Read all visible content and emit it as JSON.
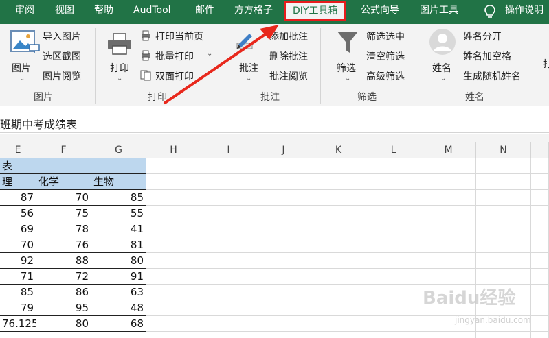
{
  "tabs": [
    "审阅",
    "视图",
    "帮助",
    "AudTool",
    "邮件",
    "方方格子",
    "DIY工具箱",
    "公式向导",
    "图片工具"
  ],
  "help_label": "操作说明",
  "ribbon": {
    "picture": {
      "big_label": "图片",
      "items": [
        "导入图片",
        "选区截图",
        "图片阅览"
      ],
      "group_label": "图片"
    },
    "print": {
      "big_label": "打印",
      "items": [
        "打印当前页",
        "批量打印",
        "双面打印"
      ],
      "group_label": "打印"
    },
    "comment": {
      "big_label": "批注",
      "items": [
        "添加批注",
        "删除批注",
        "批注阅览"
      ],
      "group_label": "批注"
    },
    "filter": {
      "big_label": "筛选",
      "items": [
        "筛选选中",
        "清空筛选",
        "高级筛选"
      ],
      "group_label": "筛选"
    },
    "name": {
      "big_label": "姓名",
      "items": [
        "姓名分开",
        "姓名加空格",
        "生成随机姓名"
      ],
      "group_label": "姓名"
    },
    "extra_label": "打"
  },
  "formula_bar": {
    "text": "班期中考成绩表"
  },
  "columns": [
    "E",
    "F",
    "G",
    "H",
    "I",
    "J",
    "K",
    "L",
    "M",
    "N"
  ],
  "sheet": {
    "title_fragment": "表",
    "headers": [
      "理",
      "化学",
      "生物"
    ],
    "rows": [
      [
        "87",
        "70",
        "85"
      ],
      [
        "56",
        "75",
        "55"
      ],
      [
        "69",
        "78",
        "41"
      ],
      [
        "70",
        "76",
        "81"
      ],
      [
        "92",
        "88",
        "80"
      ],
      [
        "71",
        "72",
        "91"
      ],
      [
        "85",
        "86",
        "63"
      ],
      [
        "79",
        "95",
        "48"
      ],
      [
        "76.125",
        "80",
        "68"
      ]
    ]
  },
  "colors": {
    "tab_bar": "#217346",
    "highlight": "#e81c1c",
    "arrow": "#e8281c",
    "header_fill": "#bdd7ee"
  },
  "watermark": {
    "brand": "Baidu经验",
    "url": "jingyan.baidu.com"
  }
}
